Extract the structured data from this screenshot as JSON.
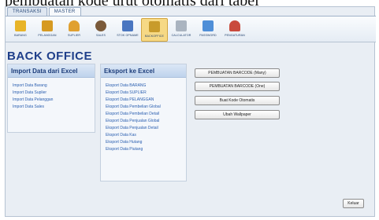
{
  "overlay_text": "pembuatan kode urut otomatis dari tabel",
  "tabs": [
    {
      "label": "TRANSAKSI",
      "active": false
    },
    {
      "label": "MASTER",
      "active": true
    }
  ],
  "toolbar": [
    {
      "label": "BARANG",
      "icon": "box-icon",
      "color": "#e8b428"
    },
    {
      "label": "PELANGGAN",
      "icon": "customer-icon",
      "color": "#d69a22"
    },
    {
      "label": "SUPLIER",
      "icon": "supplier-icon",
      "color": "#e0a030"
    },
    {
      "label": "SALES",
      "icon": "person-icon",
      "color": "#7a5a3a"
    },
    {
      "label": "STOK OPNAME",
      "icon": "chart-icon",
      "color": "#4a76c0"
    },
    {
      "label": "BACKOFFICE",
      "icon": "office-icon",
      "color": "#c89b2b",
      "selected": true
    },
    {
      "label": "CALCULATOR",
      "icon": "calculator-icon",
      "color": "#aab4c0"
    },
    {
      "label": "PASSWORD",
      "icon": "password-icon",
      "color": "#4f8fd8"
    },
    {
      "label": "PENGATURAN",
      "icon": "settings-icon",
      "color": "#c94b3d"
    }
  ],
  "title": "BACK OFFICE",
  "import_panel": {
    "title": "Import Data dari Excel",
    "items": [
      "Import Data Barang",
      "Import Data Suplier",
      "Import Data Pelanggan",
      "Import Data Sales"
    ]
  },
  "export_panel": {
    "title": "Eksport ke Excel",
    "items": [
      "Eksport Data BARANG",
      "Eksport Data SUPLIER",
      "Eksport Data PELANGGAN",
      "Eksport Data Pembelian Global",
      "Eksport Data Pembelian Detail",
      "Eksport Data Penjualan Global",
      "Eksport Data Penjualan Detail",
      "Eksport Data Kas",
      "Eksport Data Hutang",
      "Eksport Data Piutang"
    ]
  },
  "buttons": {
    "barcode_many": "PEMBUATAN BARCODE (Many)",
    "barcode_one": "PEMBUATAN BARCODE (One)",
    "kode_otomatis": "Buat Kode Otomatis",
    "wallpaper": "Ubah Wallpaper",
    "keluar": "Keluar"
  }
}
